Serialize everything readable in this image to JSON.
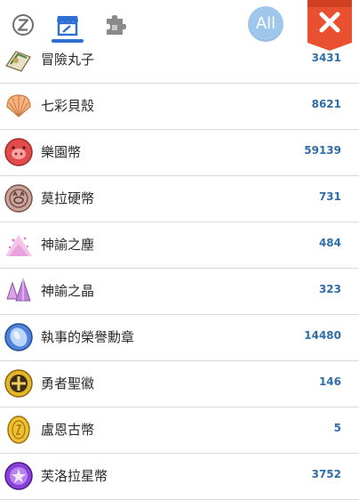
{
  "header": {
    "tabs": [
      {
        "icon": "z-coin-icon"
      },
      {
        "icon": "shop-icon"
      },
      {
        "icon": "puzzle-icon"
      }
    ],
    "active_tab": 1,
    "all_label": "All",
    "close_icon": "close-icon",
    "accent_color": "#2f6fd1",
    "close_color": "#e8502f"
  },
  "items": [
    {
      "name": "冒險丸子",
      "count": "3431",
      "icon": "dango-icon"
    },
    {
      "name": "七彩貝殼",
      "count": "8621",
      "icon": "shell-icon"
    },
    {
      "name": "樂園幣",
      "count": "59139",
      "icon": "pig-coin-icon"
    },
    {
      "name": "莫拉硬幣",
      "count": "731",
      "icon": "mora-coin-icon"
    },
    {
      "name": "神諭之塵",
      "count": "484",
      "icon": "oracle-dust-icon"
    },
    {
      "name": "神諭之晶",
      "count": "323",
      "icon": "oracle-crystal-icon"
    },
    {
      "name": "執事的榮譽勳章",
      "count": "14480",
      "icon": "butler-medal-icon"
    },
    {
      "name": "勇者聖徽",
      "count": "146",
      "icon": "hero-emblem-icon"
    },
    {
      "name": "盧恩古幣",
      "count": "5",
      "icon": "rune-coin-icon"
    },
    {
      "name": "芙洛拉星幣",
      "count": "3752",
      "icon": "flora-star-coin-icon"
    }
  ]
}
